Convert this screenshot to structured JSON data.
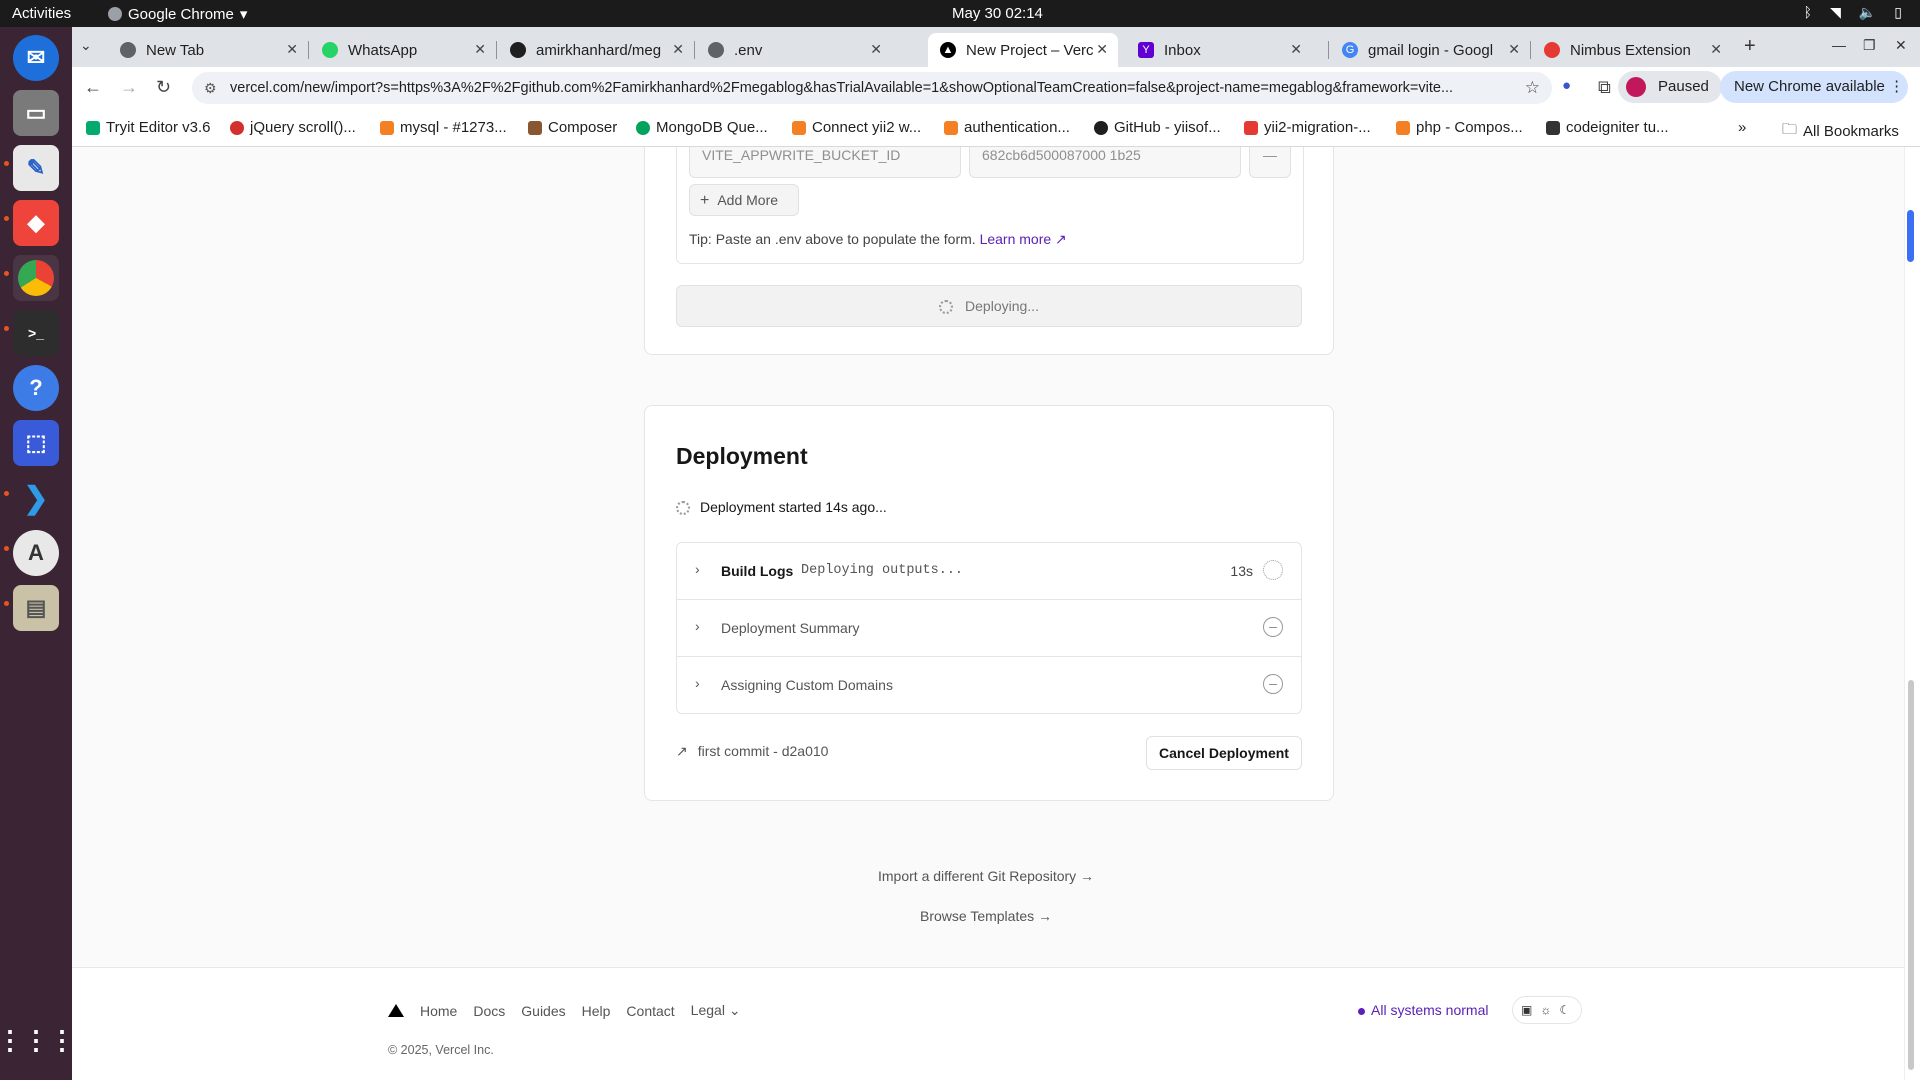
{
  "os": {
    "activities": "Activities",
    "app_name": "Google Chrome",
    "clock": "May 30  02:14"
  },
  "tabs": [
    {
      "title": "New Tab",
      "fav": "chrome-icon",
      "color": "#5f6368"
    },
    {
      "title": "WhatsApp",
      "fav": "whatsapp-icon",
      "color": "#25d366"
    },
    {
      "title": "amirkhanhard/meg",
      "fav": "github-icon",
      "color": "#1f1f1f"
    },
    {
      "title": ".env",
      "fav": "globe-icon",
      "color": "#5f6368"
    },
    {
      "title": "New Project – Verc",
      "fav": "vercel-icon",
      "color": "#000000"
    },
    {
      "title": "Inbox",
      "fav": "yahoo-icon",
      "color": "#6001d2"
    },
    {
      "title": "gmail login - Googl",
      "fav": "google-icon",
      "color": "#4285f4"
    },
    {
      "title": "Nimbus Extension",
      "fav": "nimbus-icon",
      "color": "#e53935"
    }
  ],
  "toolbar": {
    "url": "vercel.com/new/import?s=https%3A%2F%2Fgithub.com%2Famirkhanhard%2Fmegablog&hasTrialAvailable=1&showOptionalTeamCreation=false&project-name=megablog&framework=vite...",
    "paused": "Paused",
    "new_chrome": "New Chrome available"
  },
  "bookmarks": [
    {
      "label": "Tryit Editor v3.6",
      "color": "#04aa6d"
    },
    {
      "label": "jQuery scroll()...",
      "color": "#d32f2f"
    },
    {
      "label": "mysql - #1273...",
      "color": "#f48024"
    },
    {
      "label": "Composer",
      "color": "#885630"
    },
    {
      "label": "MongoDB Que...",
      "color": "#00a35c"
    },
    {
      "label": "Connect yii2 w...",
      "color": "#f48024"
    },
    {
      "label": "authentication...",
      "color": "#f48024"
    },
    {
      "label": "GitHub - yiisof...",
      "color": "#1f1f1f"
    },
    {
      "label": "yii2-migration-...",
      "color": "#e53935"
    },
    {
      "label": "php - Compos...",
      "color": "#f48024"
    },
    {
      "label": "codeigniter tu...",
      "color": "#333333"
    }
  ],
  "all_bookmarks": "All Bookmarks",
  "env": {
    "key_value": "VITE_APPWRITE_BUCKET_ID",
    "val_value": "682cb6d500087000 1b25",
    "add_more": "Add More",
    "tip": "Tip: Paste an .env above to populate the form.",
    "learn_more": "Learn more",
    "deploying": "Deploying..."
  },
  "deployment": {
    "title": "Deployment",
    "status": "Deployment started 14s ago...",
    "steps": [
      {
        "name": "Build Logs",
        "log": "Deploying outputs...",
        "time": "13s"
      },
      {
        "name": "Deployment Summary",
        "log": "",
        "time": ""
      },
      {
        "name": "Assigning Custom Domains",
        "log": "",
        "time": ""
      }
    ],
    "commit": "first commit - d2a010",
    "cancel": "Cancel Deployment"
  },
  "links": {
    "import_other": "Import a different Git Repository →",
    "browse_templates": "Browse Templates →"
  },
  "footer": {
    "nav": [
      "Home",
      "Docs",
      "Guides",
      "Help",
      "Contact",
      "Legal"
    ],
    "status": "All systems normal",
    "copyright": "© 2025, Vercel Inc."
  }
}
